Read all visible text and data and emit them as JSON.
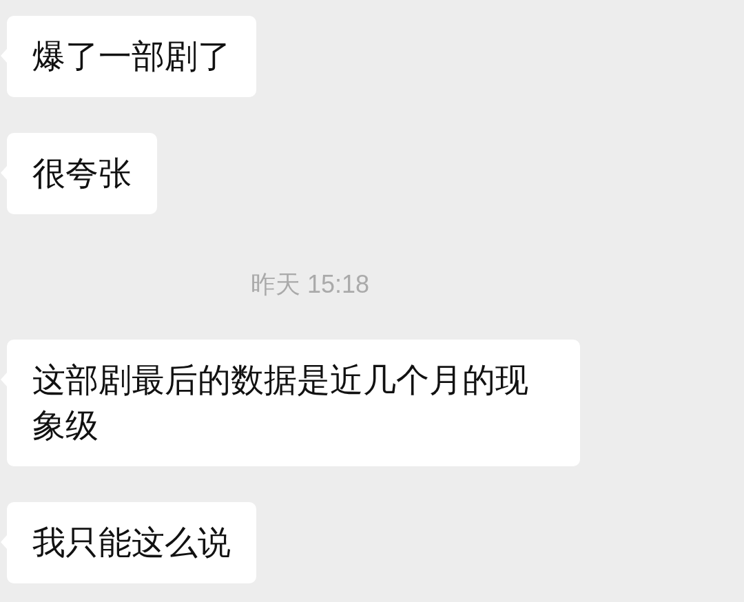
{
  "messages": [
    {
      "kind": "message",
      "text": "爆了一部剧了"
    },
    {
      "kind": "message",
      "text": "很夸张"
    },
    {
      "kind": "timestamp",
      "text": "昨天 15:18"
    },
    {
      "kind": "message",
      "text": "这部剧最后的数据是近几个月的现象级"
    },
    {
      "kind": "message",
      "text": "我只能这么说"
    }
  ]
}
